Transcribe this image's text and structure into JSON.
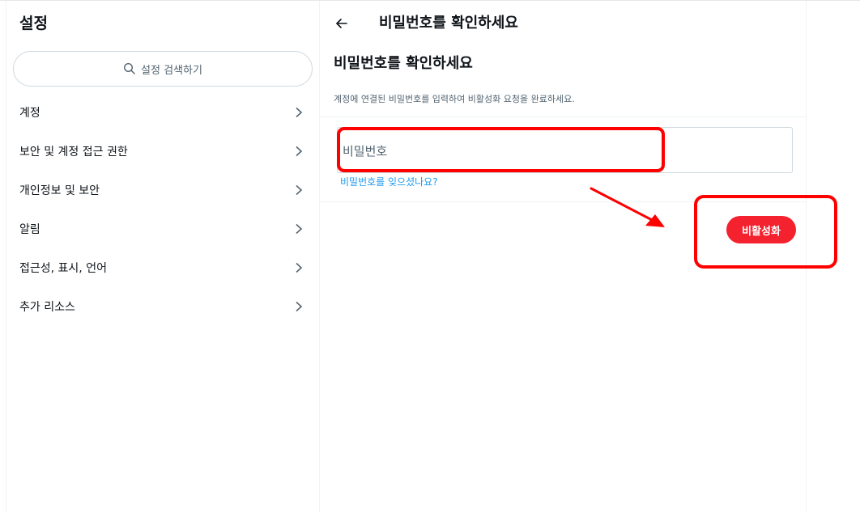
{
  "settings": {
    "title": "설정",
    "search_placeholder": "설정 검색하기",
    "menu": [
      {
        "label": "계정"
      },
      {
        "label": "보안 및 계정 접근 권한"
      },
      {
        "label": "개인정보 및 보안"
      },
      {
        "label": "알림"
      },
      {
        "label": "접근성, 표시, 언어"
      },
      {
        "label": "추가 리소스"
      }
    ]
  },
  "detail": {
    "header_title": "비밀번호를 확인하세요",
    "section_title": "비밀번호를 확인하세요",
    "description": "계정에 연결된 비밀번호를 입력하여 비활성화 요청을 완료하세요.",
    "password_placeholder": "비밀번호",
    "forgot_link": "비밀번호를 잊으셨나요?",
    "deactivate_button": "비활성화"
  },
  "colors": {
    "accent_blue": "#1d9bf0",
    "danger_red": "#f4212e",
    "annotation_red": "#ff0000"
  },
  "icons": {
    "search": "search-icon",
    "chevron": "chevron-right-icon",
    "back": "arrow-left-icon"
  }
}
